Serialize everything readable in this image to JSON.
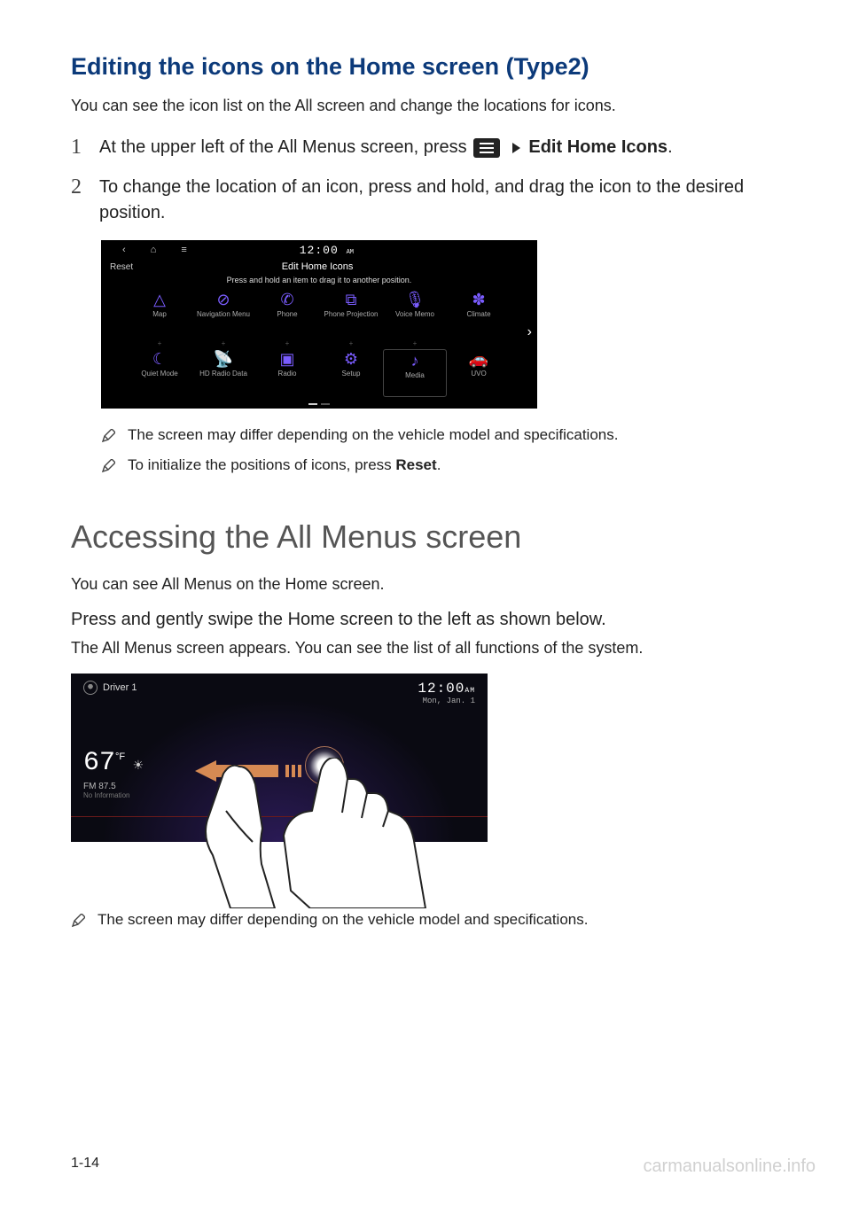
{
  "title": "Editing the icons on the Home screen (Type2)",
  "intro": "You can see the icon list on the All screen and change the locations for icons.",
  "steps": {
    "s1": {
      "num": "1",
      "pre": "At the upper left of the All Menus screen, press ",
      "post": "Edit Home Icons",
      "period": "."
    },
    "s2": {
      "num": "2",
      "text": "To change the location of an icon, press and hold, and drag the icon to the desired position."
    }
  },
  "shot1": {
    "time": "12:00",
    "ampm": "AM",
    "reset": "Reset",
    "header": "Edit Home Icons",
    "hint": "Press and hold an item to drag it to another position.",
    "icons": [
      {
        "label": "Map"
      },
      {
        "label": "Navigation Menu"
      },
      {
        "label": "Phone"
      },
      {
        "label": "Phone Projection"
      },
      {
        "label": "Voice Memo"
      },
      {
        "label": "Climate"
      },
      {
        "label": "Quiet Mode"
      },
      {
        "label": "HD Radio Data"
      },
      {
        "label": "Radio"
      },
      {
        "label": "Setup"
      },
      {
        "label": "Media"
      },
      {
        "label": "UVO"
      }
    ]
  },
  "notes1": {
    "a": "The screen may differ depending on the vehicle model and specifications.",
    "b_pre": "To initialize the positions of icons, press ",
    "b_bold": "Reset",
    "b_post": "."
  },
  "section2": {
    "heading": "Accessing the All Menus screen",
    "intro": "You can see All Menus on the Home screen.",
    "action": "Press and gently swipe the Home screen to the left as shown below.",
    "result": "The All Menus screen appears. You can see the list of all functions of the system."
  },
  "shot2": {
    "driver": "Driver 1",
    "time": "12:00",
    "ampm": "AM",
    "date": "Mon, Jan. 1",
    "temp": "67",
    "unit": "°F",
    "station": "FM 87.5",
    "noinfo": "No Information"
  },
  "note2": "The screen may differ depending on the vehicle model and specifications.",
  "page": "1-14",
  "watermark": "carmanualsonline.info"
}
